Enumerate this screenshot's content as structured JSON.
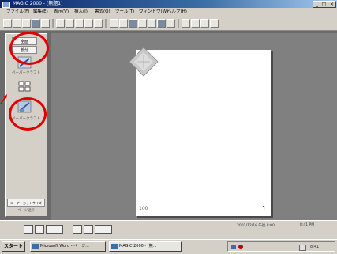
{
  "window": {
    "title": "MAGIC 2000 - [無題1]",
    "min": "_",
    "max": "□",
    "close": "×"
  },
  "menu": [
    "ファイル(F)",
    "編集(E)",
    "表示(V)",
    "挿入(I)",
    "書式(O)",
    "ツール(T)",
    "ウィンドウ(W)",
    "ヘルプ(H)"
  ],
  "sidebar": {
    "btn_top_1": "全面",
    "btn_top_2": "部分",
    "label_1": "ペーパークラフト",
    "label_2": "ペーパークラフト",
    "bottom_btn": "コーナーカットサイズ",
    "bottom_label": "ページ送り"
  },
  "page": {
    "left_number": "100",
    "right_number": "1"
  },
  "status": {
    "left": "2001/12/16 午後 8:00",
    "right": "8:41 PM"
  },
  "taskbar": {
    "start": "スタート",
    "tasks": [
      "Microsoft Word - ページ...",
      "MAGIC 2000 - [無..."
    ],
    "clock": "8:41"
  },
  "accent": {
    "highlight": "#e00000",
    "titlebar": "#0a246a"
  }
}
